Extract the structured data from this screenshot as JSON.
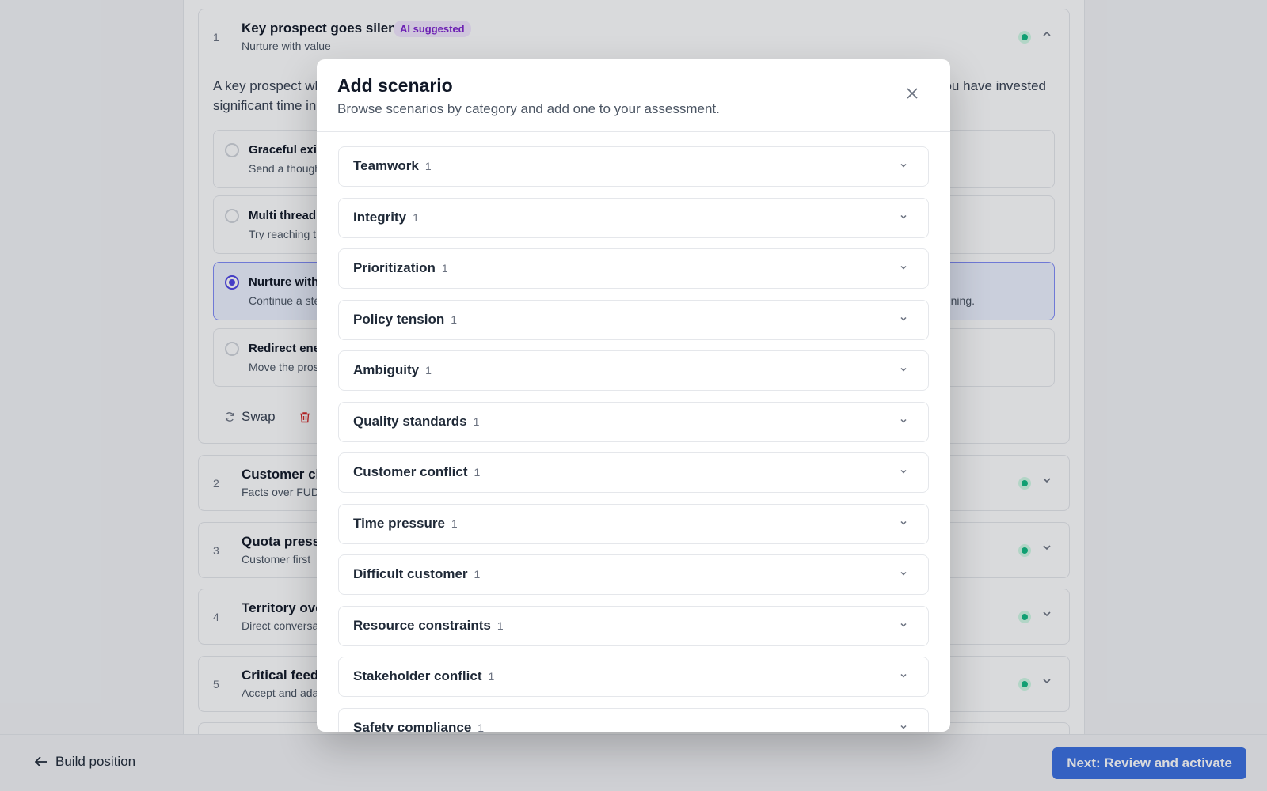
{
  "background": {
    "cards": [
      {
        "num": "1",
        "title": "Key prospect goes silent",
        "badge": "AI suggested",
        "subtitle": "Nurture with value",
        "description": "A key prospect wh",
        "description_end": "ou have invested",
        "description_line2": "significant time in",
        "options": [
          {
            "title": "Graceful exit",
            "desc": "Send a though",
            "desc_right": ""
          },
          {
            "title": "Multi thread",
            "desc": "Try reaching t",
            "desc_right": ""
          },
          {
            "title": "Nurture with",
            "desc": "Continue a ste",
            "desc_right": "ning."
          },
          {
            "title": "Redirect ene",
            "desc": "Move the pros",
            "desc_right": ""
          }
        ],
        "actions": {
          "swap": "Swap"
        }
      },
      {
        "num": "2",
        "title": "Customer cit",
        "subtitle": "Facts over FUD"
      },
      {
        "num": "3",
        "title": "Quota pressu",
        "subtitle": "Customer first"
      },
      {
        "num": "4",
        "title": "Territory ove",
        "subtitle": "Direct conversa"
      },
      {
        "num": "5",
        "title": "Critical feedb",
        "subtitle": "Accept and ada"
      }
    ]
  },
  "footer": {
    "back_label": "Build position",
    "next_label": "Next: Review and activate"
  },
  "modal": {
    "title": "Add scenario",
    "subtitle": "Browse scenarios by category and add one to your assessment.",
    "categories": [
      {
        "label": "Teamwork",
        "count": "1"
      },
      {
        "label": "Integrity",
        "count": "1"
      },
      {
        "label": "Prioritization",
        "count": "1"
      },
      {
        "label": "Policy tension",
        "count": "1"
      },
      {
        "label": "Ambiguity",
        "count": "1"
      },
      {
        "label": "Quality standards",
        "count": "1"
      },
      {
        "label": "Customer conflict",
        "count": "1"
      },
      {
        "label": "Time pressure",
        "count": "1"
      },
      {
        "label": "Difficult customer",
        "count": "1"
      },
      {
        "label": "Resource constraints",
        "count": "1"
      },
      {
        "label": "Stakeholder conflict",
        "count": "1"
      },
      {
        "label": "Safety compliance",
        "count": "1"
      }
    ]
  },
  "colors": {
    "primary": "#3b6fe0",
    "ai_badge": "#7e22ce",
    "status_green": "#10b981",
    "selected_radio": "#4f46e5",
    "delete_red": "#dc2626"
  },
  "icons": [
    "chevron-up-icon",
    "chevron-down-icon",
    "close-icon",
    "refresh-icon",
    "trash-icon",
    "arrow-left-icon"
  ]
}
